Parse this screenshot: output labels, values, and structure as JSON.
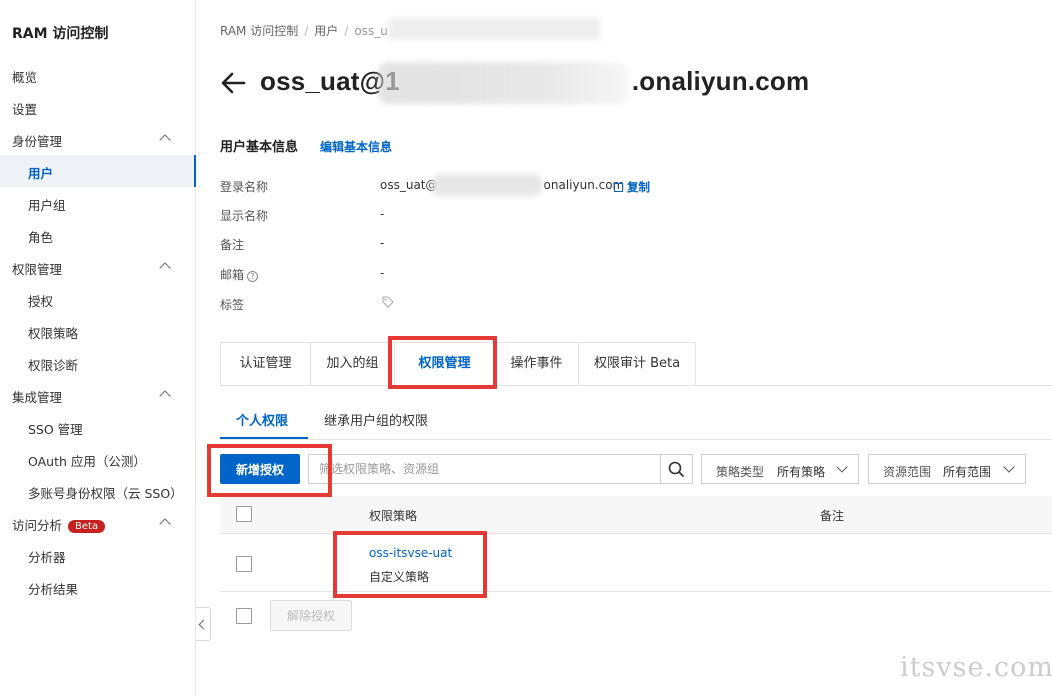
{
  "sidebar": {
    "title": "RAM 访问控制",
    "items": [
      {
        "label": "概览"
      },
      {
        "label": "设置"
      },
      {
        "label": "身份管理"
      },
      {
        "label": "用户"
      },
      {
        "label": "用户组"
      },
      {
        "label": "角色"
      },
      {
        "label": "权限管理"
      },
      {
        "label": "授权"
      },
      {
        "label": "权限策略"
      },
      {
        "label": "权限诊断"
      },
      {
        "label": "集成管理"
      },
      {
        "label": "SSO 管理"
      },
      {
        "label": "OAuth 应用（公测）"
      },
      {
        "label": "多账号身份权限（云 SSO）"
      },
      {
        "label": "访问分析",
        "badge": "Beta"
      },
      {
        "label": "分析器"
      },
      {
        "label": "分析结果"
      }
    ]
  },
  "breadcrumb": [
    "RAM 访问控制",
    "用户",
    "oss_u"
  ],
  "header": {
    "title_prefix": "oss_uat@1",
    "title_suffix": ".onaliyun.com"
  },
  "basic_info": {
    "section_title": "用户基本信息",
    "edit_link": "编辑基本信息",
    "labels": [
      "登录名称",
      "显示名称",
      "备注",
      "邮箱",
      "标签"
    ],
    "login_prefix": "oss_uat@",
    "login_suffix": "onaliyun.com",
    "copy_label": "复制",
    "display_name": "-",
    "remark": "-",
    "email": "-"
  },
  "tabs": [
    "认证管理",
    "加入的组",
    "权限管理",
    "操作事件",
    "权限审计 Beta"
  ],
  "subtabs": [
    "个人权限",
    "继承用户组的权限"
  ],
  "toolbar": {
    "add_button": "新增授权",
    "search_placeholder": "筛选权限策略、资源组",
    "policy_type_label": "策略类型",
    "policy_type_value": "所有策略",
    "scope_label": "资源范围",
    "scope_value": "所有范围"
  },
  "table": {
    "columns": [
      "权限策略",
      "备注"
    ],
    "rows": [
      {
        "policy": "oss-itsvse-uat",
        "type": "自定义策略"
      }
    ]
  },
  "footer": {
    "revoke_button": "解除授权"
  },
  "watermark": "itsvse.com",
  "colors": {
    "accent": "#0064c8",
    "highlight": "#e53935",
    "badge": "#c8201f"
  }
}
